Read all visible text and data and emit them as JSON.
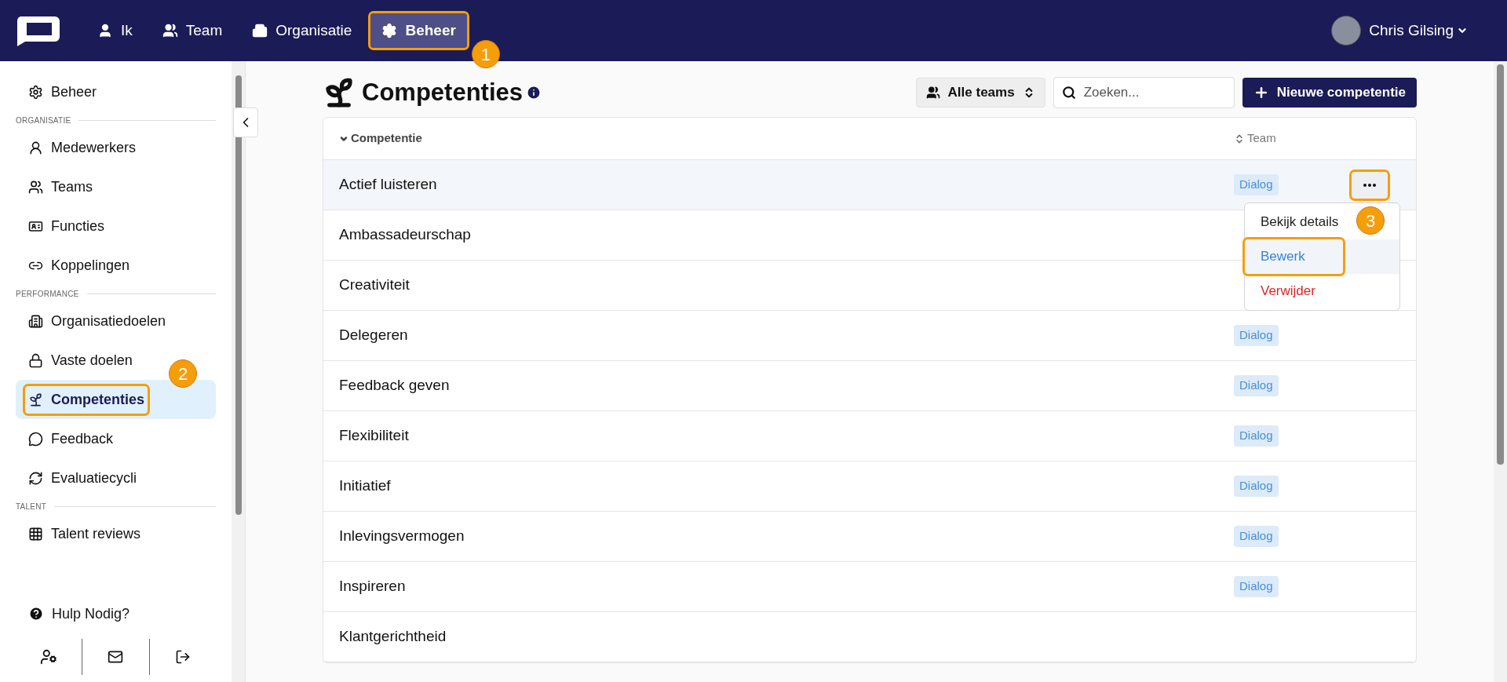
{
  "nav": {
    "items": [
      {
        "label": "Ik",
        "selected": false
      },
      {
        "label": "Team",
        "selected": false
      },
      {
        "label": "Organisatie",
        "selected": false
      },
      {
        "label": "Beheer",
        "selected": true,
        "callout": "1"
      }
    ],
    "user": {
      "name": "Chris Gilsing"
    }
  },
  "sidebar": {
    "sections": [
      {
        "items": [
          {
            "label": "Beheer",
            "selected": false
          }
        ]
      },
      {
        "heading": "ORGANISATIE",
        "items": [
          {
            "label": "Medewerkers",
            "selected": false
          },
          {
            "label": "Teams",
            "selected": false
          },
          {
            "label": "Functies",
            "selected": false
          },
          {
            "label": "Koppelingen",
            "selected": false
          }
        ]
      },
      {
        "heading": "PERFORMANCE",
        "items": [
          {
            "label": "Organisatiedoelen",
            "selected": false
          },
          {
            "label": "Vaste doelen",
            "selected": false
          },
          {
            "label": "Competenties",
            "selected": true,
            "callout": "2"
          },
          {
            "label": "Feedback",
            "selected": false
          },
          {
            "label": "Evaluatiecycli",
            "selected": false
          }
        ]
      },
      {
        "heading": "TALENT",
        "items": [
          {
            "label": "Talent reviews",
            "selected": false
          }
        ]
      }
    ],
    "help": "Hulp Nodig?"
  },
  "page": {
    "title": "Competenties",
    "team_filter": "Alle teams",
    "search": {
      "placeholder": "Zoeken..."
    },
    "new_button": "Nieuwe competentie"
  },
  "table": {
    "columns": [
      {
        "label": "Competentie",
        "sorted_descending": true
      },
      {
        "label": "Team",
        "sorted_descending": false
      }
    ],
    "rows": [
      {
        "name": "Actief luisteren",
        "team": "Dialog",
        "hovered": true,
        "menu_open": true
      },
      {
        "name": "Ambassadeurschap",
        "hovered": false,
        "menu_open": false
      },
      {
        "name": "Creativiteit",
        "hovered": false,
        "menu_open": false
      },
      {
        "name": "Delegeren",
        "team": "Dialog",
        "hovered": false,
        "menu_open": false
      },
      {
        "name": "Feedback geven",
        "team": "Dialog",
        "hovered": false,
        "menu_open": false
      },
      {
        "name": "Flexibiliteit",
        "team": "Dialog",
        "hovered": false,
        "menu_open": false
      },
      {
        "name": "Initiatief",
        "team": "Dialog",
        "hovered": false,
        "menu_open": false
      },
      {
        "name": "Inlevingsvermogen",
        "team": "Dialog",
        "hovered": false,
        "menu_open": false
      },
      {
        "name": "Inspireren",
        "team": "Dialog",
        "hovered": false,
        "menu_open": false
      },
      {
        "name": "Klantgerichtheid",
        "hovered": false,
        "menu_open": false
      }
    ]
  },
  "row_menu": {
    "items": [
      {
        "label": "Bekijk details",
        "kind": "normal",
        "highlighted": false
      },
      {
        "label": "Bewerk",
        "kind": "edit",
        "highlighted": true,
        "callout": "3"
      },
      {
        "label": "Verwijder",
        "kind": "danger",
        "highlighted": false
      }
    ]
  }
}
